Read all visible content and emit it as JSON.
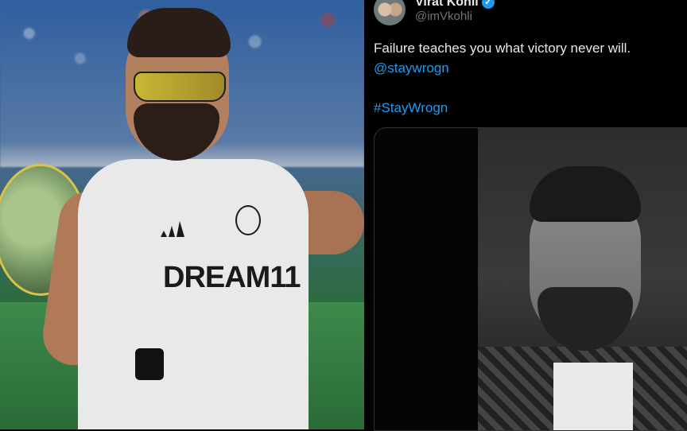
{
  "tweet": {
    "name": "Virat Kohli",
    "handle": "@imVkohli",
    "text": "Failure teaches you what victory never will.",
    "mention": "@staywrogn",
    "hashtag": "#StayWrogn"
  },
  "photo": {
    "jersey_text": "DREAM11"
  },
  "colors": {
    "link": "#1d9bf0",
    "background": "#000000",
    "text": "#e7e9ea",
    "muted": "#71767b"
  }
}
